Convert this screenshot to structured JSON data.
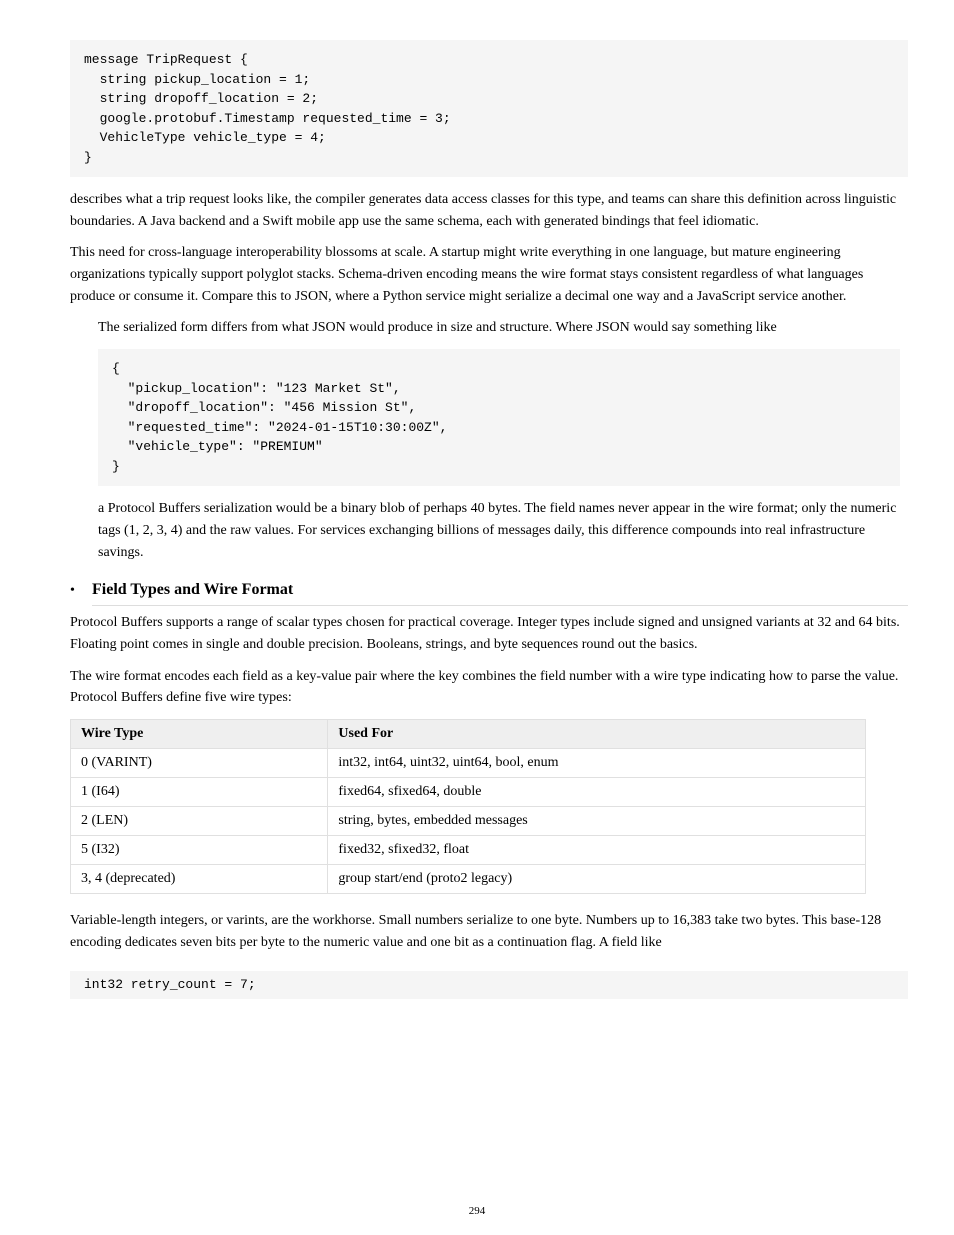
{
  "code1": "message TripRequest {\n  string pickup_location = 1;\n  string dropoff_location = 2;\n  google.protobuf.Timestamp requested_time = 3;\n  VehicleType vehicle_type = 4;\n}",
  "para1": "describes what a trip request looks like, the compiler generates data access classes for this type, and teams can share this definition across linguistic boundaries. A Java backend and a Swift mobile app use the same schema, each with generated bindings that feel idiomatic.",
  "para2": "This need for cross-language interoperability blossoms at scale. A startup might write everything in one language, but mature engineering organizations typically support polyglot stacks. Schema-driven encoding means the wire format stays consistent regardless of what languages produce or consume it. Compare this to JSON, where a Python service might serialize a decimal one way and a JavaScript service another.",
  "para3": "The serialized form differs from what JSON would produce in size and structure. Where JSON would say something like",
  "code2": "{\n  \"pickup_location\": \"123 Market St\",\n  \"dropoff_location\": \"456 Mission St\",\n  \"requested_time\": \"2024-01-15T10:30:00Z\",\n  \"vehicle_type\": \"PREMIUM\"\n}",
  "para4": "a Protocol Buffers serialization would be a binary blob of perhaps 40 bytes. The field names never appear in the wire format; only the numeric tags (1, 2, 3, 4) and the raw values. For services exchanging billions of messages daily, this difference compounds into real infrastructure savings.",
  "bullet_title": "Field Types and Wire Format",
  "para5": "Protocol Buffers supports a range of scalar types chosen for practical coverage. Integer types include signed and unsigned variants at 32 and 64 bits. Floating point comes in single and double precision. Booleans, strings, and byte sequences round out the basics.",
  "para6": "The wire format encodes each field as a key-value pair where the key combines the field number with a wire type indicating how to parse the value. Protocol Buffers define five wire types:",
  "table": {
    "headers": [
      "Wire Type",
      "Used For"
    ],
    "rows": [
      [
        "0 (VARINT)",
        "int32, int64, uint32, uint64, bool, enum"
      ],
      [
        "1 (I64)",
        "fixed64, sfixed64, double"
      ],
      [
        "2 (LEN)",
        "string, bytes, embedded messages"
      ],
      [
        "5 (I32)",
        "fixed32, sfixed32, float"
      ],
      [
        "3, 4 (deprecated)",
        "group start/end (proto2 legacy)"
      ]
    ]
  },
  "para7": "Variable-length integers, or varints, are the workhorse. Small numbers serialize to one byte. Numbers up to 16,383 take two bytes. This base-128 encoding dedicates seven bits per byte to the numeric value and one bit as a continuation flag. A field like",
  "code3": "int32 retry_count = 7;",
  "page_number": "294"
}
